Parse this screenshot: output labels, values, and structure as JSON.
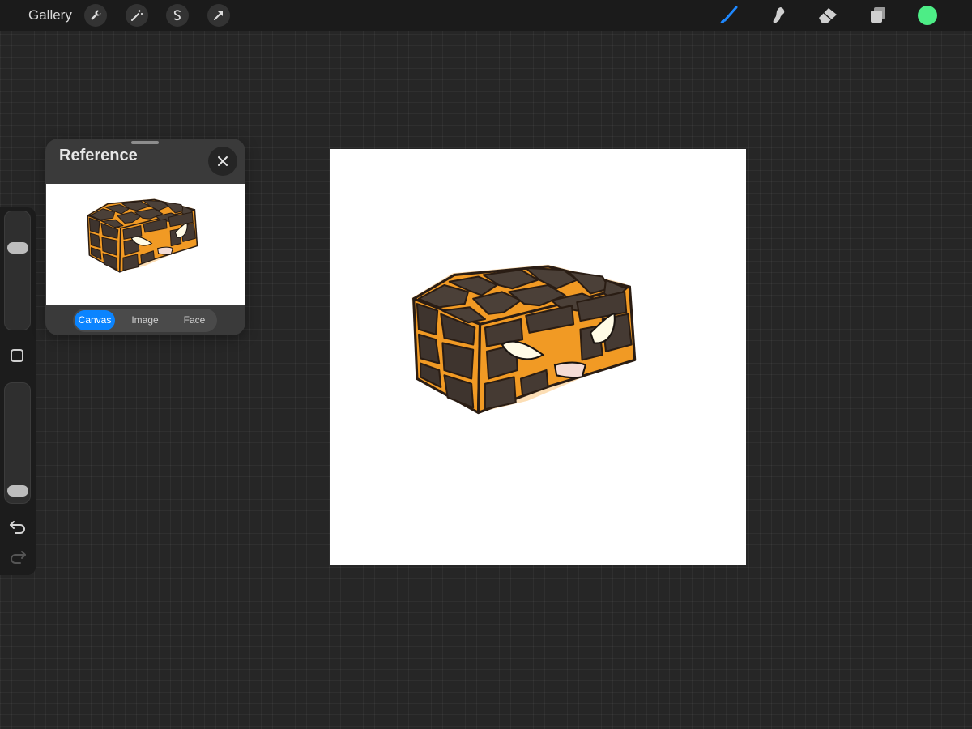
{
  "topbar": {
    "gallery_label": "Gallery",
    "left_tools": [
      "wrench-icon",
      "magic-wand-icon",
      "selection-icon",
      "transform-arrow-icon"
    ],
    "right_tools": [
      "brush-icon",
      "smudge-icon",
      "eraser-icon",
      "layers-icon"
    ],
    "active_tool": "brush-icon",
    "active_tool_color": "#1e88ff",
    "current_color": "#4ded86"
  },
  "sidebar": {
    "brush_size_level": 0.72,
    "opacity_level": 0.04,
    "controls": [
      "modify-button",
      "undo-icon",
      "redo-icon"
    ]
  },
  "reference": {
    "title": "Reference",
    "close_icon": "close-icon",
    "segments": [
      {
        "label": "Canvas",
        "active": true
      },
      {
        "label": "Image",
        "active": false
      },
      {
        "label": "Face",
        "active": false
      }
    ],
    "accent_color": "#0a84ff"
  },
  "canvas": {
    "background": "#ffffff",
    "artwork": "lava-rock-block-character"
  }
}
